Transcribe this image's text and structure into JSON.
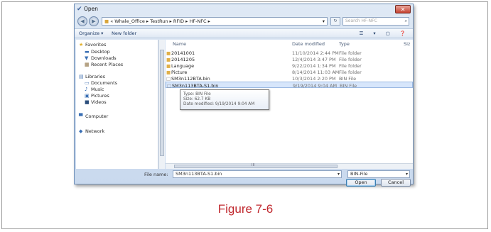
{
  "dialog": {
    "title": "Open",
    "close_glyph": "✕",
    "nav": {
      "back": "◀",
      "forward": "▶"
    },
    "address": "« Whale_Office ▸ TestRun ▸ RFID ▸ HF-NFC ▸",
    "address_dropdown": "▾",
    "refresh_glyph": "↻",
    "search_placeholder": "Search HF-NFC",
    "toolbar": {
      "organize": "Organize ▾",
      "new_folder": "New folder",
      "icons": "☰ ▾ ▢ ❓"
    },
    "nav_pane": {
      "favorites_label": "Favorites",
      "favorites": [
        "Desktop",
        "Downloads",
        "Recent Places"
      ],
      "libraries_label": "Libraries",
      "libraries": [
        "Documents",
        "Music",
        "Pictures",
        "Videos"
      ],
      "computer_label": "Computer",
      "network_label": "Network"
    },
    "columns": {
      "name": "Name",
      "date": "Date modified",
      "type": "Type",
      "size": "Siz"
    },
    "files": [
      {
        "name": "20141001",
        "date": "11/10/2014 2:44 PM",
        "type": "File folder",
        "icon": "folder-icon"
      },
      {
        "name": "20141205",
        "date": "12/4/2014 3:47 PM",
        "type": "File folder",
        "icon": "folder-icon"
      },
      {
        "name": "Language",
        "date": "9/22/2014 1:34 PM",
        "type": "File folder",
        "icon": "folder-icon"
      },
      {
        "name": "Picture",
        "date": "8/14/2014 11:03 AM",
        "type": "File folder",
        "icon": "folder-icon"
      },
      {
        "name": "SM3n112BTA.bin",
        "date": "10/3/2014 2:20 PM",
        "type": "BIN File",
        "icon": "file-icon"
      },
      {
        "name": "SM3n113BTA-S1.bin",
        "date": "9/19/2014 9:04 AM",
        "type": "BIN File",
        "icon": "file-icon",
        "selected": true
      }
    ],
    "tooltip": {
      "type_line": "Type: BIN File",
      "size_line": "Size: 62.7 KB",
      "date_line": "Date modified: 9/19/2014 9:04 AM"
    },
    "hscroll_grip": "III",
    "file_name_label": "File name:",
    "file_name_value": "SM3n113BTA-S1.bin",
    "file_type_value": "BIN-File",
    "open_button": "Open",
    "cancel_button": "Cancel"
  },
  "caption": "Figure 7-6",
  "colors": {
    "caption": "#c0272d",
    "selection": "#d7e6fb",
    "folder": "#e0b04a"
  }
}
